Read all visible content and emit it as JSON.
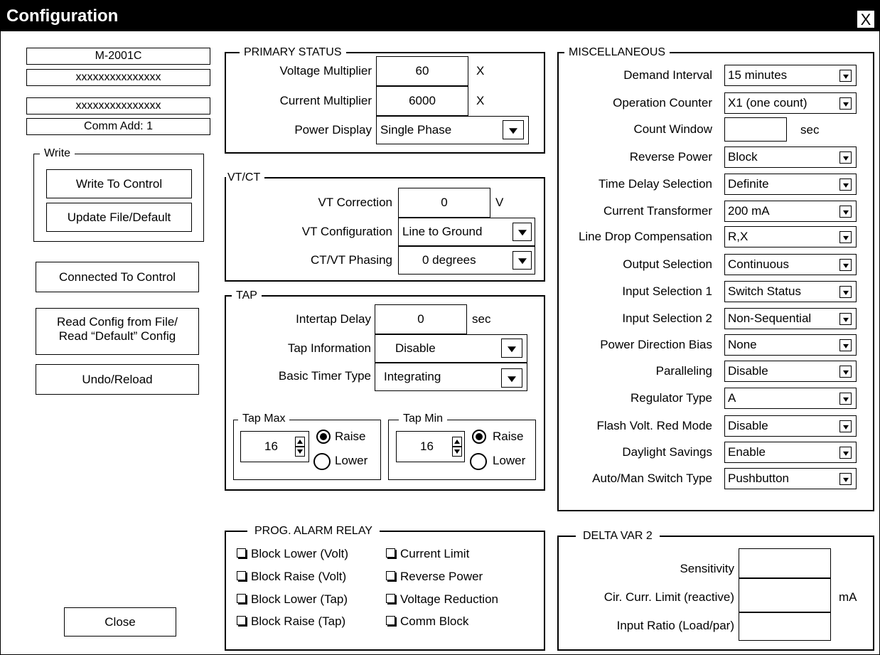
{
  "window": {
    "title": "Configuration",
    "close_glyph": "X"
  },
  "info": {
    "model": "M-2001C",
    "line1": "xxxxxxxxxxxxxxx",
    "line2": "xxxxxxxxxxxxxxx",
    "comm_addr": "Comm Add: 1"
  },
  "write": {
    "legend": "Write",
    "write_to_control": "Write To Control",
    "update_file": "Update File/Default"
  },
  "buttons": {
    "connected": "Connected To Control",
    "read_config_1": "Read Config from File/",
    "read_config_2": "Read “Default” Config",
    "undo": "Undo/Reload",
    "close": "Close"
  },
  "primary_status": {
    "legend": "PRIMARY STATUS",
    "voltage_multiplier_label": "Voltage Multiplier",
    "voltage_multiplier": "60",
    "current_multiplier_label": "Current Multiplier",
    "current_multiplier": "6000",
    "unit_x": "X",
    "power_display_label": "Power Display",
    "power_display": "Single Phase"
  },
  "vtct": {
    "legend": "VT/CT",
    "vt_correction_label": "VT Correction",
    "vt_correction": "0",
    "vt_unit": "V",
    "vt_configuration_label": "VT Configuration",
    "vt_configuration": "Line to Ground",
    "phasing_label": "CT/VT Phasing",
    "phasing": "0 degrees"
  },
  "tap": {
    "legend": "TAP",
    "intertap_delay_label": "Intertap Delay",
    "intertap_delay": "0",
    "sec": "sec",
    "tap_information_label": "Tap Information",
    "tap_information": "Disable",
    "basic_timer_label": "Basic Timer Type",
    "basic_timer": "Integrating",
    "tap_max": {
      "legend": "Tap Max",
      "value": "16",
      "raise": "Raise",
      "lower": "Lower",
      "selected": "Raise"
    },
    "tap_min": {
      "legend": "Tap Min",
      "value": "16",
      "raise": "Raise",
      "lower": "Lower",
      "selected": "Raise"
    }
  },
  "misc": {
    "legend": "MISCELLANEOUS",
    "sec": "sec",
    "rows": [
      {
        "label": "Demand Interval",
        "value": "15 minutes"
      },
      {
        "label": "Operation Counter",
        "value": "X1 (one count)"
      },
      {
        "label": "Count Window",
        "value": ""
      },
      {
        "label": "Reverse Power",
        "value": "Block"
      },
      {
        "label": "Time Delay Selection",
        "value": "Definite"
      },
      {
        "label": "Current Transformer",
        "value": "200 mA"
      },
      {
        "label": "Line Drop Compensation",
        "value": "R,X"
      },
      {
        "label": "Output Selection",
        "value": "Continuous"
      },
      {
        "label": "Input Selection 1",
        "value": "Switch Status"
      },
      {
        "label": "Input Selection 2",
        "value": "Non-Sequential"
      },
      {
        "label": "Power Direction Bias",
        "value": "None"
      },
      {
        "label": "Paralleling",
        "value": "Disable"
      },
      {
        "label": "Regulator Type",
        "value": "A"
      },
      {
        "label": "Flash Volt. Red Mode",
        "value": "Disable"
      },
      {
        "label": "Daylight Savings",
        "value": "Enable"
      },
      {
        "label": "Auto/Man Switch Type",
        "value": "Pushbutton"
      }
    ]
  },
  "alarm": {
    "legend": "PROG. ALARM RELAY",
    "items": [
      "Block Lower (Volt)",
      "Current Limit",
      "Block Raise (Volt)",
      "Reverse Power",
      "Block Lower (Tap)",
      "Voltage Reduction",
      "Block Raise (Tap)",
      "Comm Block"
    ]
  },
  "delta": {
    "legend": "DELTA VAR 2",
    "sensitivity_label": "Sensitivity",
    "sensitivity": "",
    "circ_label": "Cir. Curr. Limit (reactive)",
    "circ": "",
    "unit": "mA",
    "ratio_label": "Input Ratio (Load/par)",
    "ratio": ""
  }
}
